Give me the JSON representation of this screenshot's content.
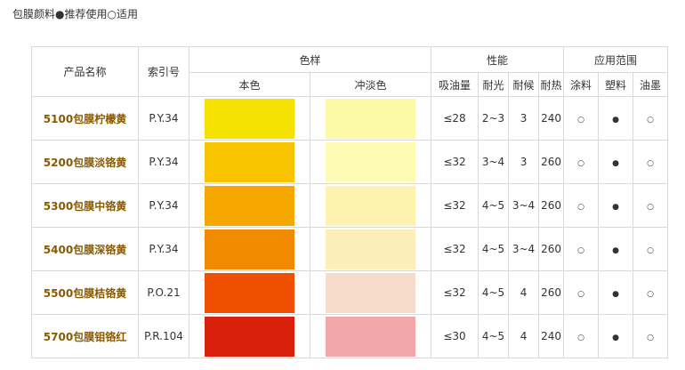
{
  "caption": "包膜颜料●推荐使用○适用",
  "headers": {
    "product_name": "产品名称",
    "index_no": "索引号",
    "color_sample": "色样",
    "properties": "性能",
    "application": "应用范围",
    "masstone": "本色",
    "tint": "冲淡色",
    "oil_absorption": "吸油量",
    "lightfastness": "耐光",
    "weather_resistance": "耐候",
    "heat_resistance": "耐热",
    "coatings": "涂料",
    "plastics": "塑料",
    "ink": "油墨"
  },
  "rows": [
    {
      "product": "5100包膜柠檬黄",
      "index": "P.Y.34",
      "masstone_color": "#f6e200",
      "tint_color": "#fdfaa7",
      "oil_absorption": "≤28",
      "lightfastness": "2~3",
      "weather": "3",
      "heat": "240",
      "coatings": "○",
      "plastics": "●",
      "ink": "○"
    },
    {
      "product": "5200包膜淡铬黄",
      "index": "P.Y.34",
      "masstone_color": "#f8c400",
      "tint_color": "#fefbb4",
      "oil_absorption": "≤32",
      "lightfastness": "3~4",
      "weather": "3",
      "heat": "260",
      "coatings": "○",
      "plastics": "●",
      "ink": "○"
    },
    {
      "product": "5300包膜中铬黄",
      "index": "P.Y.34",
      "masstone_color": "#f7a800",
      "tint_color": "#fdf3ae",
      "oil_absorption": "≤32",
      "lightfastness": "4~5",
      "weather": "3~4",
      "heat": "260",
      "coatings": "○",
      "plastics": "●",
      "ink": "○"
    },
    {
      "product": "5400包膜深铬黄",
      "index": "P.Y.34",
      "masstone_color": "#f28a00",
      "tint_color": "#fceeb8",
      "oil_absorption": "≤32",
      "lightfastness": "4~5",
      "weather": "3~4",
      "heat": "260",
      "coatings": "○",
      "plastics": "●",
      "ink": "○"
    },
    {
      "product": "5500包膜桔铬黄",
      "index": "P.O.21",
      "masstone_color": "#ee4f00",
      "tint_color": "#f8dccb",
      "oil_absorption": "≤32",
      "lightfastness": "4~5",
      "weather": "4",
      "heat": "260",
      "coatings": "○",
      "plastics": "●",
      "ink": "○"
    },
    {
      "product": "5700包膜钼铬红",
      "index": "P.R.104",
      "masstone_color": "#d8200d",
      "tint_color": "#f2a8a8",
      "oil_absorption": "≤30",
      "lightfastness": "4~5",
      "weather": "4",
      "heat": "240",
      "coatings": "○",
      "plastics": "●",
      "ink": "○"
    }
  ]
}
